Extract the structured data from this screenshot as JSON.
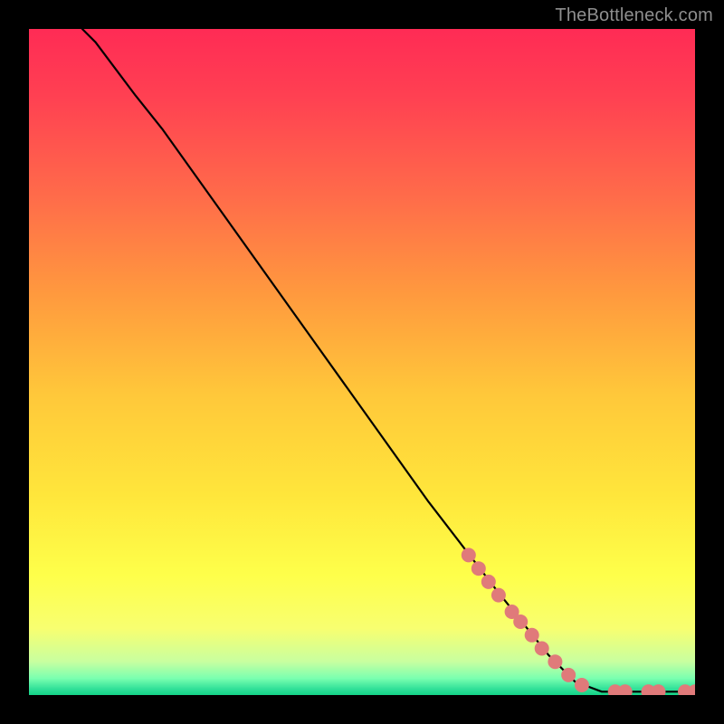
{
  "attribution": "TheBottleneck.com",
  "colors": {
    "dot": "#e07a7a",
    "line": "#000000",
    "frame": "#000000"
  },
  "chart_data": {
    "type": "line",
    "title": "",
    "xlabel": "",
    "ylabel": "",
    "xlim": [
      0,
      100
    ],
    "ylim": [
      0,
      100
    ],
    "grid": false,
    "legend": false,
    "series": [
      {
        "name": "curve",
        "style": "line",
        "points": [
          {
            "x": 8,
            "y": 100
          },
          {
            "x": 10,
            "y": 98
          },
          {
            "x": 13,
            "y": 94
          },
          {
            "x": 16,
            "y": 90
          },
          {
            "x": 20,
            "y": 85
          },
          {
            "x": 30,
            "y": 71
          },
          {
            "x": 40,
            "y": 57
          },
          {
            "x": 50,
            "y": 43
          },
          {
            "x": 60,
            "y": 29
          },
          {
            "x": 70,
            "y": 16
          },
          {
            "x": 78,
            "y": 6
          },
          {
            "x": 82,
            "y": 2
          },
          {
            "x": 86,
            "y": 0.5
          },
          {
            "x": 100,
            "y": 0.5
          }
        ]
      },
      {
        "name": "highlighted-points",
        "style": "scatter",
        "points": [
          {
            "x": 66,
            "y": 21
          },
          {
            "x": 67.5,
            "y": 19
          },
          {
            "x": 69,
            "y": 17
          },
          {
            "x": 70.5,
            "y": 15
          },
          {
            "x": 72.5,
            "y": 12.5
          },
          {
            "x": 73.8,
            "y": 11
          },
          {
            "x": 75.5,
            "y": 9
          },
          {
            "x": 77,
            "y": 7
          },
          {
            "x": 79,
            "y": 5
          },
          {
            "x": 81,
            "y": 3
          },
          {
            "x": 83,
            "y": 1.5
          },
          {
            "x": 88,
            "y": 0.5
          },
          {
            "x": 89.5,
            "y": 0.5
          },
          {
            "x": 93,
            "y": 0.5
          },
          {
            "x": 94.5,
            "y": 0.5
          },
          {
            "x": 98.5,
            "y": 0.5
          },
          {
            "x": 100,
            "y": 0.5
          }
        ]
      }
    ]
  }
}
